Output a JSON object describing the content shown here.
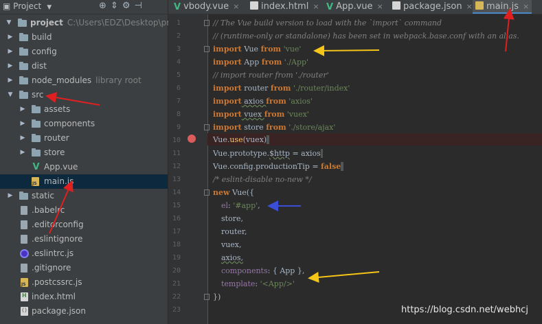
{
  "project": {
    "title": "Project",
    "tree": [
      {
        "label": "project",
        "note": "C:\\Users\\EDZ\\Desktop\\proje",
        "bold": true
      },
      {
        "label": "build"
      },
      {
        "label": "config"
      },
      {
        "label": "dist"
      },
      {
        "label": "node_modules",
        "note": "library root"
      },
      {
        "label": "src"
      },
      {
        "label": "assets"
      },
      {
        "label": "components"
      },
      {
        "label": "router"
      },
      {
        "label": "store"
      },
      {
        "label": "App.vue"
      },
      {
        "label": "main.js"
      },
      {
        "label": "static"
      },
      {
        "label": ".babelrc"
      },
      {
        "label": ".editorconfig"
      },
      {
        "label": ".eslintignore"
      },
      {
        "label": ".eslintrc.js"
      },
      {
        "label": ".gitignore"
      },
      {
        "label": ".postcssrc.js"
      },
      {
        "label": "index.html"
      },
      {
        "label": "package.json"
      }
    ]
  },
  "tabs": [
    {
      "label": "vbody.vue"
    },
    {
      "label": "index.html"
    },
    {
      "label": "App.vue"
    },
    {
      "label": "package.json"
    },
    {
      "label": "main.js"
    }
  ],
  "code": {
    "line_numbers": [
      "1",
      "2",
      "3",
      "4",
      "5",
      "6",
      "7",
      "8",
      "9",
      "10",
      "11",
      "12",
      "13",
      "14",
      "15",
      "16",
      "17",
      "18",
      "19",
      "20",
      "21",
      "22",
      "23"
    ],
    "l1": "// The Vue build version to load with the `import` command",
    "l2": "// (runtime-only or standalone) has been set in webpack.base.conf with an alias.",
    "l3_kw": "import",
    "l3_id": " Vue ",
    "l3_from": "from",
    "l3_str": " 'vue'",
    "l4_kw": "import",
    "l4_id": " App ",
    "l4_from": "from",
    "l4_str": " './App'",
    "l5": "// import router from './router'",
    "l6_kw": "import",
    "l6_id": " router ",
    "l6_from": "from",
    "l6_str": " './router/index'",
    "l7_kw": "import",
    "l7_id": " axios ",
    "l7_from": "from",
    "l7_str": " 'axios'",
    "l8_kw": "import",
    "l8_id": " vuex ",
    "l8_from": "from",
    "l8_str": " 'vuex'",
    "l9_kw": "import",
    "l9_id": " store ",
    "l9_from": "from",
    "l9_str": " './store/ajax'",
    "l10_a": "Vue.",
    "l10_fn": "use",
    "l10_b": "(vuex)",
    "l11_a": "Vue.prototype.",
    "l11_p": "$http",
    "l11_b": " = axios",
    "l12_a": "Vue.config.productionTip = ",
    "l12_kw": "false",
    "l13": "/* eslint-disable no-new */",
    "l14_kw": "new",
    "l14_b": " Vue({",
    "l15_p": "el",
    "l15_c": ": ",
    "l15_s": "'#app'",
    "l15_e": ",",
    "l16": "store,",
    "l17": "router,",
    "l18": "vuex,",
    "l19": "axios,",
    "l20_p": "components",
    "l20_b": ": { App },",
    "l21_p": "template",
    "l21_c": ": ",
    "l21_s": "'<App/>'",
    "l22": "})"
  },
  "watermark": "https://blog.csdn.net/webhcj",
  "colors": {
    "keyword": "#cc7832",
    "string": "#6a8759",
    "comment": "#808080",
    "property": "#9876aa",
    "arrow_red": "#e02020",
    "arrow_yellow": "#f5c518",
    "arrow_blue": "#3a4fd8"
  }
}
